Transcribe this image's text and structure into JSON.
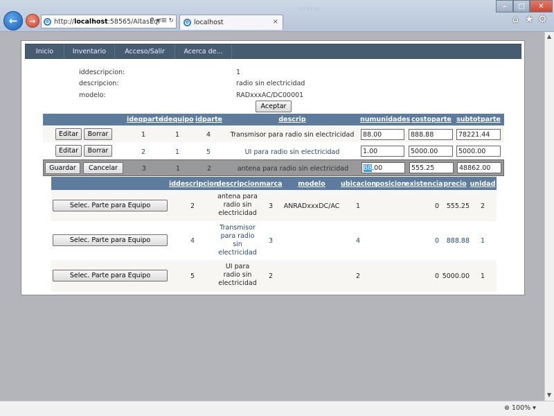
{
  "browser": {
    "url_prefix": "http://",
    "url_host": "localhost",
    "url_rest": ":58565/AltasEqF",
    "tab_title": "localhost",
    "zoom": "100%",
    "window_controls": [
      "minimize-icon",
      "maximize-icon",
      "close-icon"
    ],
    "toolbar_icons": [
      "home-icon",
      "favorites-star-icon",
      "gear-icon"
    ]
  },
  "menu": {
    "items": [
      "Inicio",
      "Inventario",
      "Acceso/Salir",
      "Acerca de..."
    ]
  },
  "details": [
    {
      "label": "iddescripcion:",
      "value": "1"
    },
    {
      "label": "descripcion:",
      "value": "radio sin electricidad"
    },
    {
      "label": "modelo:",
      "value": "RADxxxAC/DC00001"
    }
  ],
  "accept_label": "Aceptar",
  "grid1": {
    "headers": [
      "ideqparte",
      "idequipo",
      "idparte",
      "descrip",
      "numunidades",
      "costoparte",
      "subtotparte"
    ],
    "edit_label": "Editar",
    "delete_label": "Borrar",
    "save_label": "Guardar",
    "cancel_label": "Cancelar",
    "rows": [
      {
        "ideqparte": "1",
        "idequipo": "1",
        "idparte": "4",
        "descrip": "Transmisor para radio sin electricidad",
        "numunidades": "88.00",
        "costoparte": "888.88",
        "subtotparte": "78221.44",
        "mode": "view"
      },
      {
        "ideqparte": "2",
        "idequipo": "1",
        "idparte": "5",
        "descrip": "UI para radio sin electricidad",
        "numunidades": "1.00",
        "costoparte": "5000.00",
        "subtotparte": "5000.00",
        "mode": "view"
      },
      {
        "ideqparte": "3",
        "idequipo": "1",
        "idparte": "2",
        "descrip": "antena para radio sin electricidad",
        "numunidades_selected": "88",
        "numunidades_rest": ".00",
        "costoparte": "555.25",
        "subtotparte": "48862.00",
        "mode": "edit"
      }
    ]
  },
  "grid2": {
    "headers": [
      "iddescripcion",
      "descripcion",
      "marca",
      "modelo",
      "ubicacion",
      "posicion",
      "existencia",
      "precio",
      "unidad"
    ],
    "select_label": "Selec. Parte para Equipo",
    "rows": [
      {
        "iddescripcion": "2",
        "descripcion": [
          "antena para",
          "radio sin",
          "electricidad"
        ],
        "marca": "3",
        "modelo": "ANRADxxxDC/AC",
        "ubicacion": "1",
        "posicion": "",
        "existencia": "0",
        "precio": "555.25",
        "unidad": "2"
      },
      {
        "iddescripcion": "4",
        "descripcion": [
          "Transmisor",
          "para radio",
          "sin",
          "electricidad"
        ],
        "marca": "3",
        "modelo": "",
        "ubicacion": "4",
        "posicion": "",
        "existencia": "0",
        "precio": "888.88",
        "unidad": "1"
      },
      {
        "iddescripcion": "5",
        "descripcion": [
          "UI para",
          "radio sin",
          "electricidad"
        ],
        "marca": "2",
        "modelo": "",
        "ubicacion": "2",
        "posicion": "",
        "existencia": "0",
        "precio": "5000.00",
        "unidad": "1"
      }
    ]
  },
  "colors": {
    "header_bg": "#5d7b9d",
    "menu_bg": "#465c71",
    "row_alt_bg": "#f7f6f3",
    "row_link_text": "#284775",
    "edit_row_bg": "#999999",
    "selection_bg": "#3399ff"
  }
}
